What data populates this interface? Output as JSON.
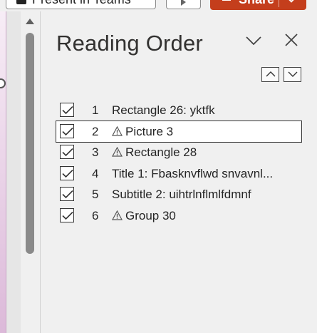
{
  "ribbon": {
    "present_label": "Present in Teams",
    "share_label": "Share"
  },
  "pane": {
    "title": "Reading Order",
    "menu_icon": "chevron-down-icon",
    "close_icon": "close-icon",
    "move_up_icon": "arrow-up-icon",
    "move_down_icon": "arrow-down-icon",
    "items": [
      {
        "checked": true,
        "number": "1",
        "warning": false,
        "label": "Rectangle 26: yktfk"
      },
      {
        "checked": true,
        "number": "2",
        "warning": true,
        "label": "Picture 3",
        "selected": true
      },
      {
        "checked": true,
        "number": "3",
        "warning": true,
        "label": "Rectangle 28"
      },
      {
        "checked": true,
        "number": "4",
        "warning": false,
        "label": "Title 1: Fbasknvflwd snvavnl..."
      },
      {
        "checked": true,
        "number": "5",
        "warning": false,
        "label": "Subtitle 2: uihtrlnflmlfdmnf"
      },
      {
        "checked": true,
        "number": "6",
        "warning": true,
        "label": "Group 30"
      }
    ]
  },
  "colors": {
    "share_bg": "#c43e1c",
    "pane_bg": "#f0f0f0",
    "scroll_thumb": "#8a8a8a"
  }
}
